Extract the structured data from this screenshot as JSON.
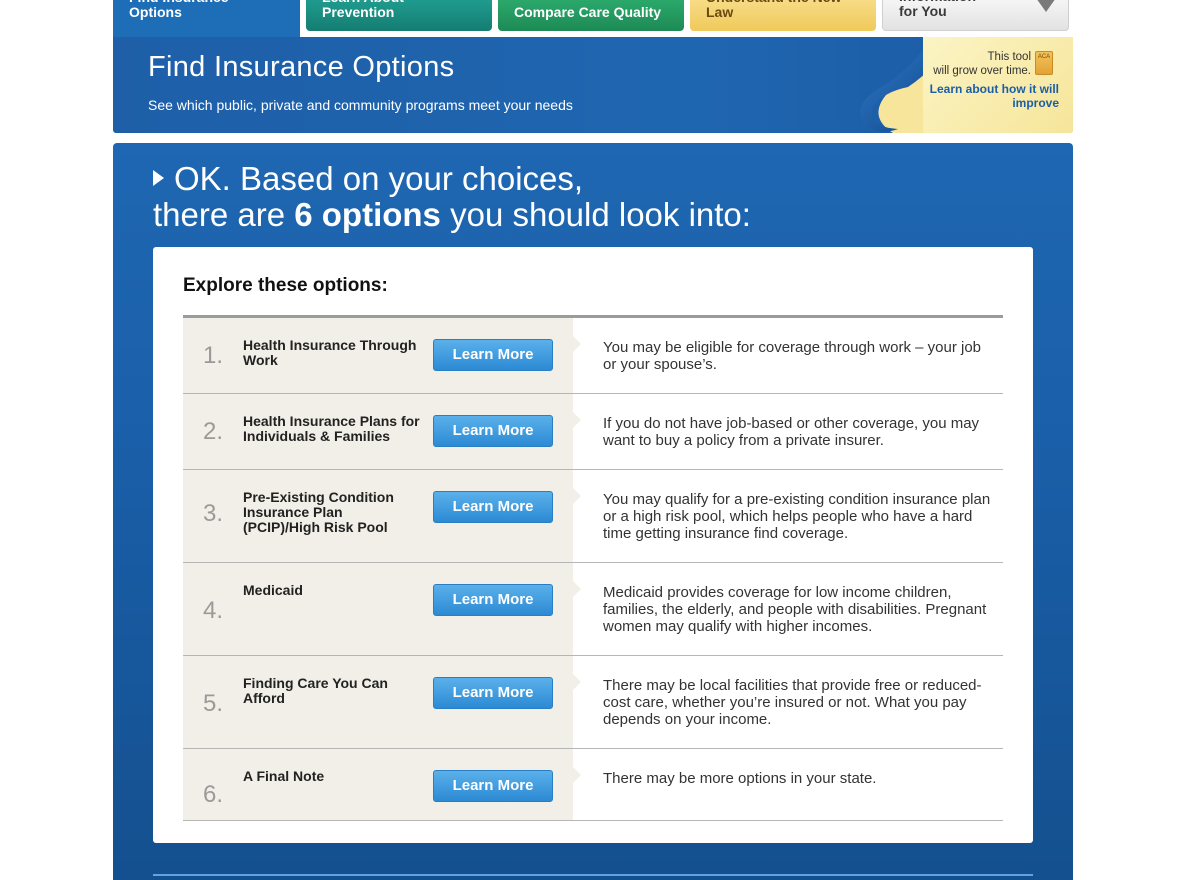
{
  "tabs": [
    {
      "label": "Find Insurance\nOptions"
    },
    {
      "label": "Learn About\nPrevention"
    },
    {
      "label": "Compare Care Quality"
    },
    {
      "label": "Understand the New\nLaw"
    },
    {
      "label": "Information\nfor You"
    }
  ],
  "header": {
    "title": "Find Insurance Options",
    "subtitle": "See which public, private and community programs meet your needs",
    "note_text": "This tool\nwill grow over time.",
    "note_icon_label": "ACA",
    "note_link": "Learn about how it will improve"
  },
  "headline": {
    "line1": "OK. Based on your choices,",
    "line2_pre": "there are ",
    "line2_bold": "6 options",
    "line2_post": " you should look into:"
  },
  "card": {
    "title": "Explore these options:",
    "button_label": "Learn More",
    "options": [
      {
        "num": "1.",
        "title": "Health Insurance Through Work",
        "desc": "You may be eligible for coverage through work – your job or your spouse’s."
      },
      {
        "num": "2.",
        "title": "Health Insurance Plans for Individuals & Families",
        "desc": "If you do not have job-based or other coverage, you may want to buy a policy from a private insurer."
      },
      {
        "num": "3.",
        "title": "Pre-Existing Condition Insurance Plan (PCIP)/High Risk Pool",
        "desc": "You may qualify for a pre-existing condition insurance plan or a high risk pool, which helps people who have a hard time getting insurance find coverage."
      },
      {
        "num": "4.",
        "title": "Medicaid",
        "desc": "Medicaid provides coverage for low income children, families, the elderly, and people with disabilities. Pregnant women may qualify with higher incomes."
      },
      {
        "num": "5.",
        "title": "Finding Care You Can Afford",
        "desc": "There may be local facilities that provide free or reduced-cost care, whether you’re insured or not. What you pay depends on your income."
      },
      {
        "num": "6.",
        "title": "A Final Note",
        "desc": "There may be more options in your state."
      }
    ]
  }
}
